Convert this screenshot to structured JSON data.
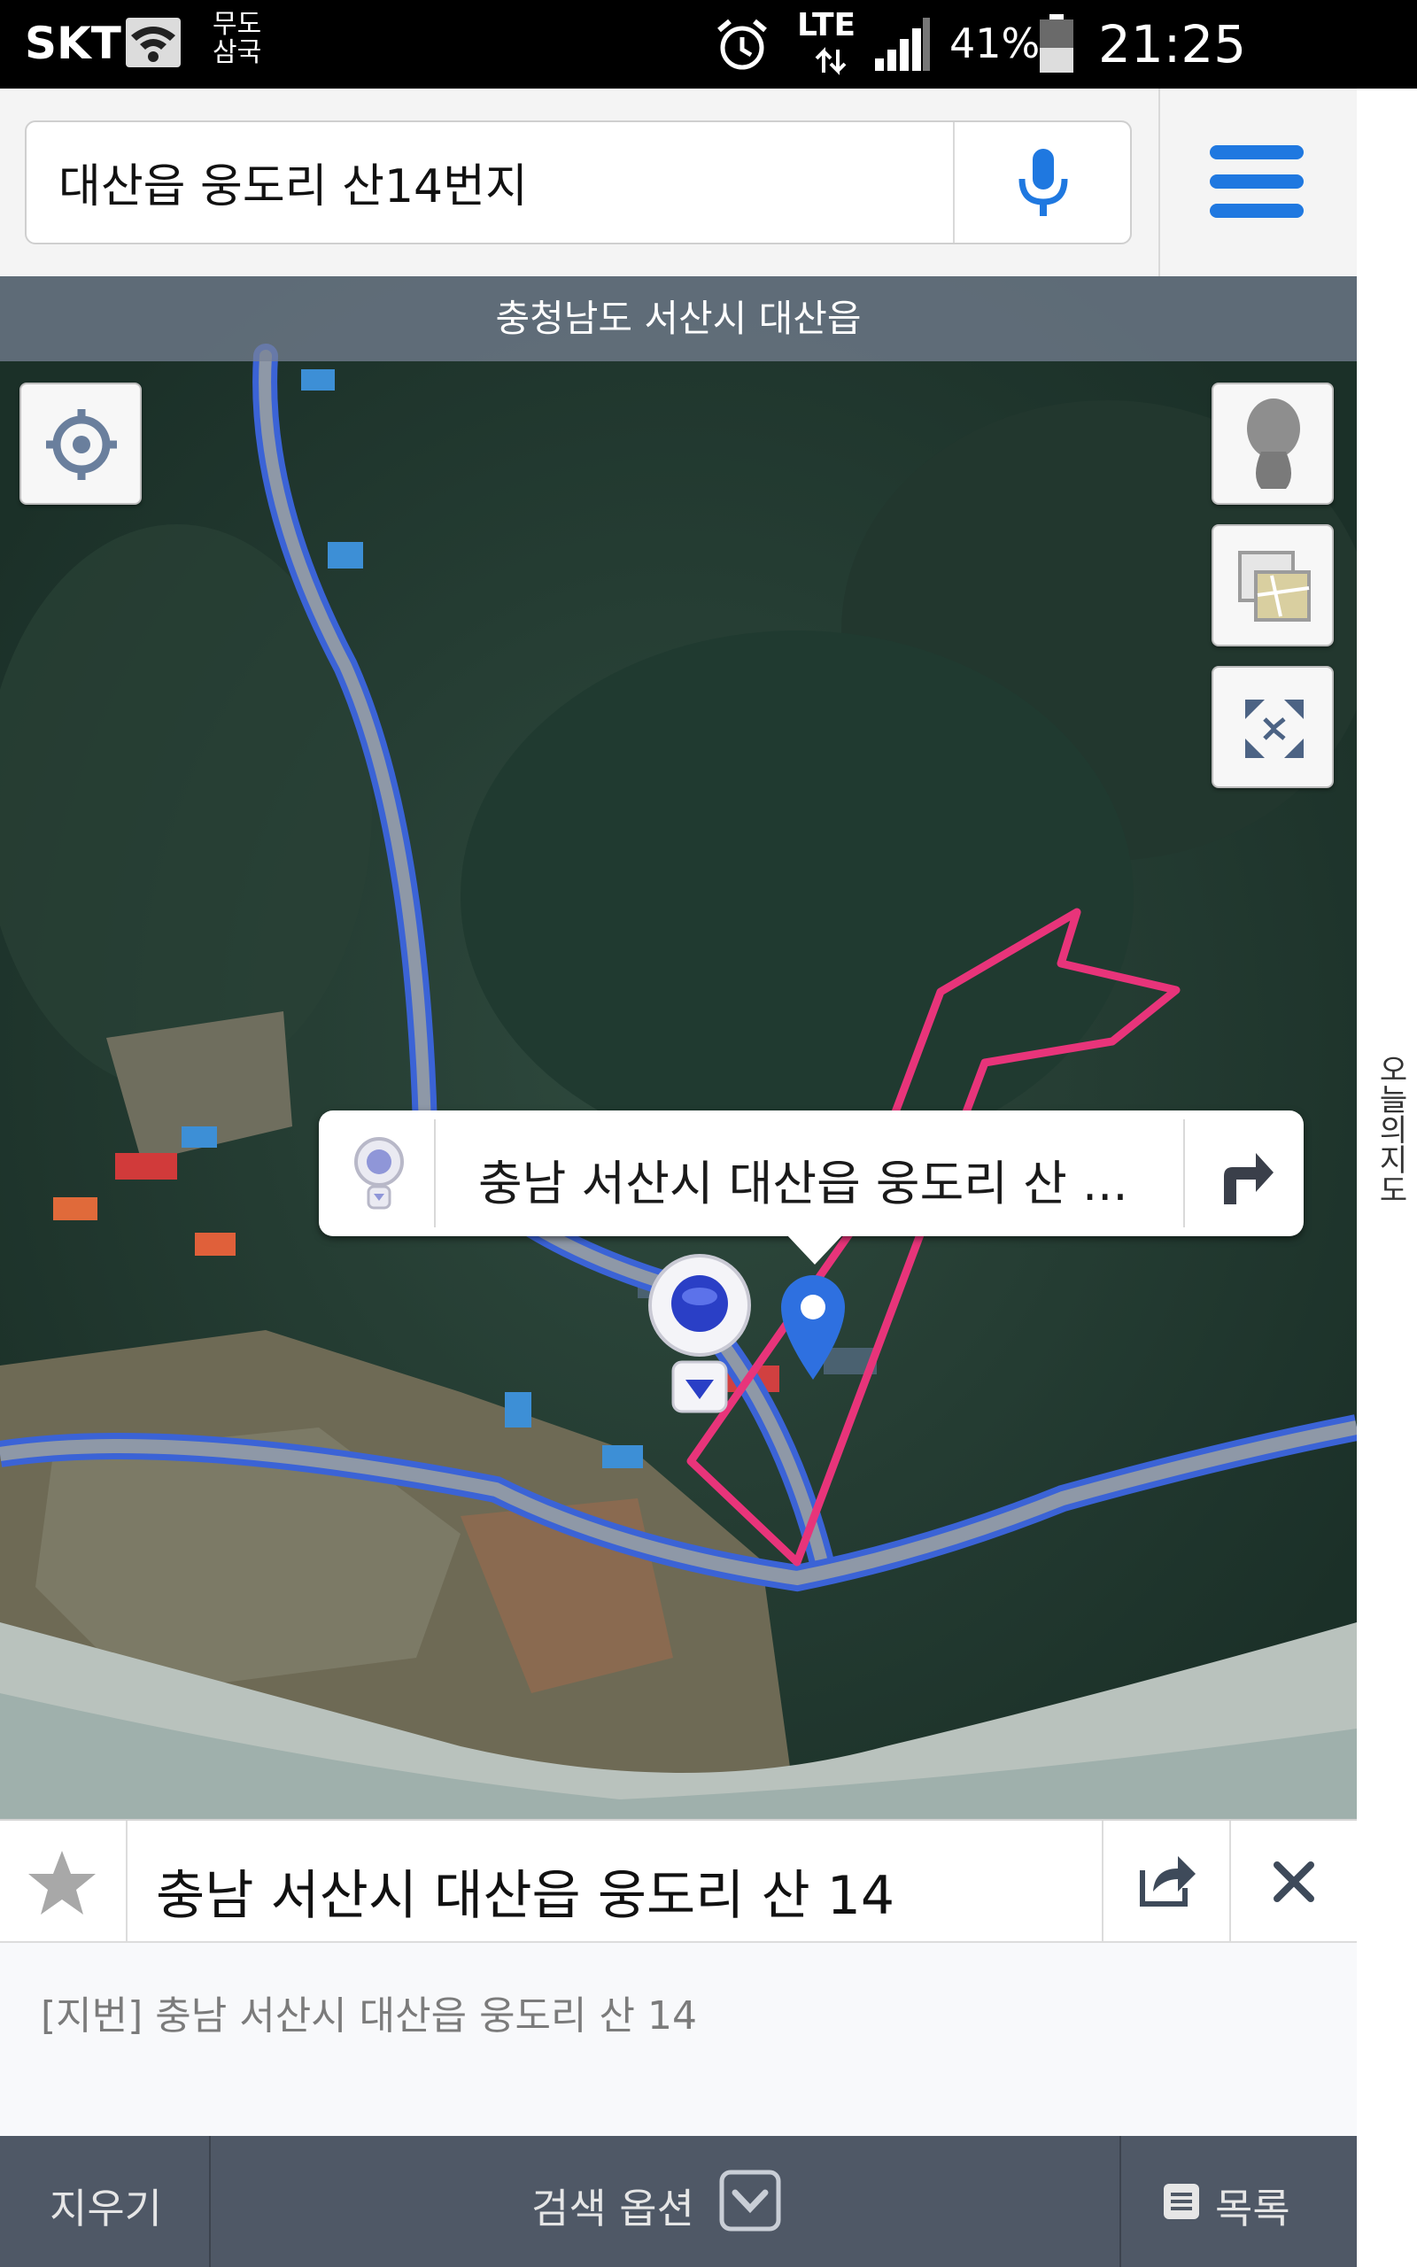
{
  "status_bar": {
    "carrier": "SKT",
    "wifi_note": "무도\n삼국",
    "network": "LTE",
    "battery": "41%",
    "time": "21:25"
  },
  "search": {
    "query": "대산읍 웅도리 산14번지",
    "mic_icon": "microphone-icon",
    "menu_icon": "hamburger-menu-icon"
  },
  "map": {
    "region_label": "충청남도 서산시 대산읍",
    "controls": [
      "current-location-icon",
      "street-view-person-icon",
      "map-layer-icon",
      "fullscreen-icon"
    ],
    "callout_text": "충남 서산시 대산읍 웅도리 산 ...",
    "boundary_color": "#e8347a",
    "road_color": "#3b63d6"
  },
  "edge_label": "오늘의지도",
  "result": {
    "title": "충남 서산시 대산읍 웅도리 산 14",
    "lot_address": "[지번] 충남 서산시 대산읍 웅도리 산 14"
  },
  "bottom_bar": {
    "clear_label": "지우기",
    "options_label": "검색 옵션",
    "list_label": "목록"
  }
}
